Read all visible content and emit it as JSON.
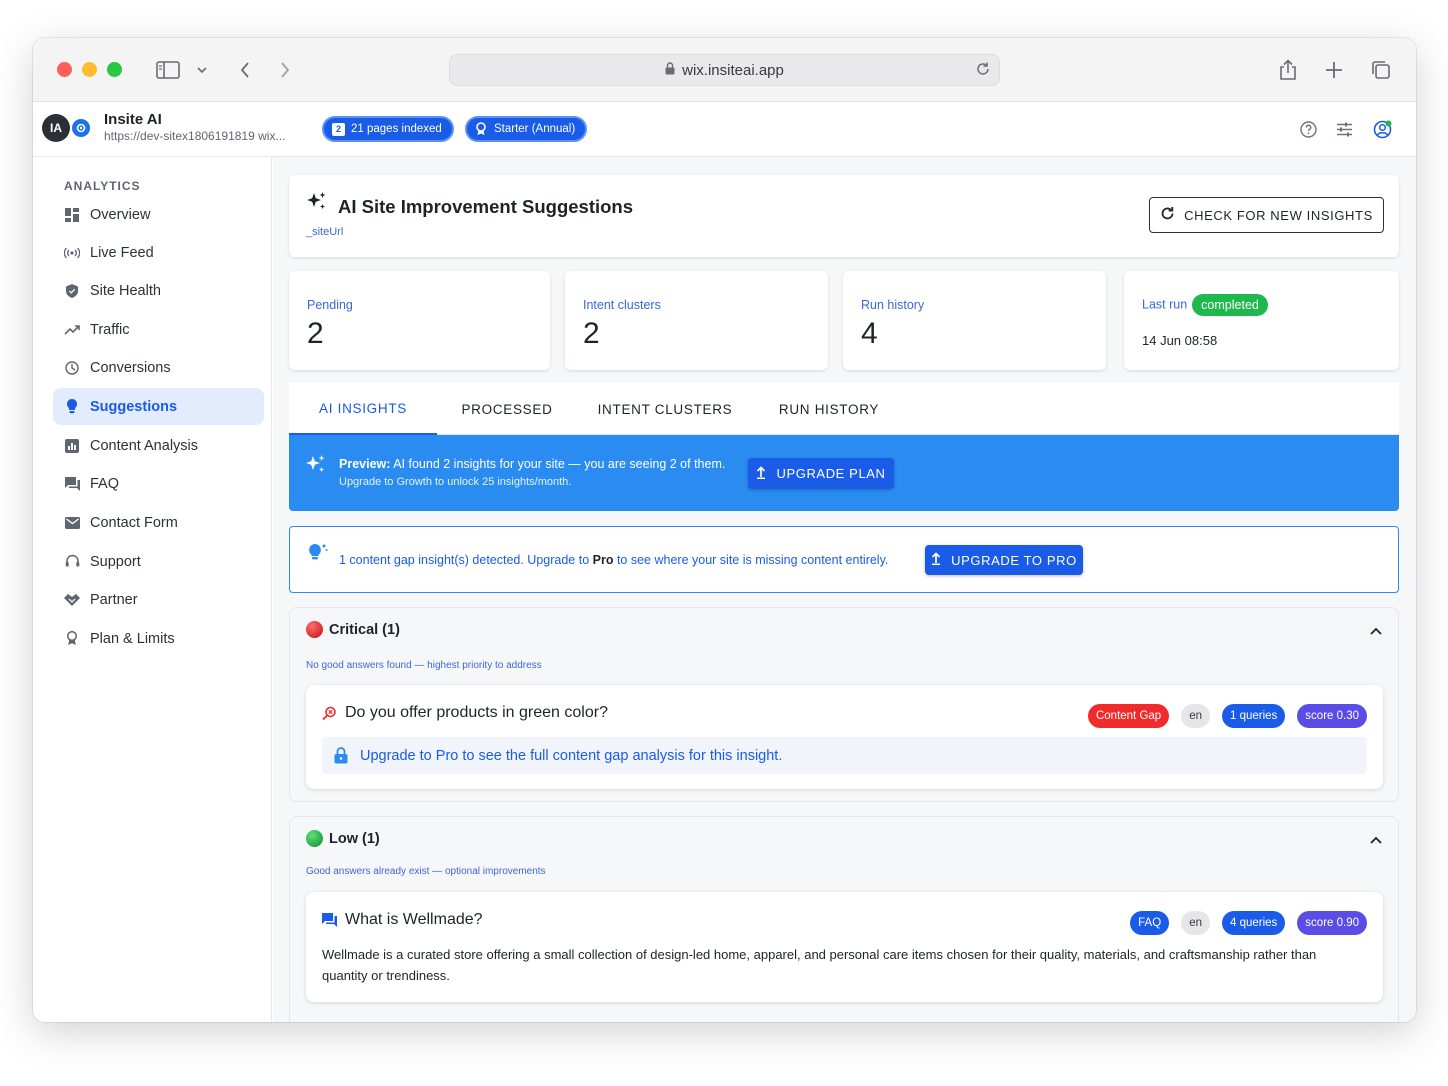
{
  "browser": {
    "url": "wix.insiteai.app"
  },
  "header": {
    "avatar_initials": "IA",
    "app_title": "Insite AI",
    "site_url": "https://dev-sitex1806191819 wix...",
    "pages_badge_icon": "2",
    "pages_badge": "21 pages indexed",
    "plan_badge": "Starter (Annual)"
  },
  "sidebar": {
    "section_label": "ANALYTICS",
    "items": [
      {
        "label": "Overview",
        "icon": "grid-icon"
      },
      {
        "label": "Live Feed",
        "icon": "broadcast-icon"
      },
      {
        "label": "Site Health",
        "icon": "shield-icon"
      },
      {
        "label": "Traffic",
        "icon": "trend-icon"
      },
      {
        "label": "Conversions",
        "icon": "conversions-icon"
      },
      {
        "label": "Suggestions",
        "icon": "bulb-icon",
        "active": true
      },
      {
        "label": "Content Analysis",
        "icon": "analysis-icon"
      },
      {
        "label": "FAQ",
        "icon": "chat-icon"
      },
      {
        "label": "Contact Form",
        "icon": "mail-icon"
      },
      {
        "label": "Support",
        "icon": "support-icon"
      },
      {
        "label": "Partner",
        "icon": "handshake-icon"
      },
      {
        "label": "Plan & Limits",
        "icon": "award-icon"
      }
    ]
  },
  "page": {
    "title": "AI Site Improvement Suggestions",
    "subtitle": "_siteUrl",
    "check_button": "CHECK FOR NEW INSIGHTS"
  },
  "stats": {
    "pending_label": "Pending",
    "pending_value": "2",
    "clusters_label": "Intent clusters",
    "clusters_value": "2",
    "history_label": "Run history",
    "history_value": "4",
    "last_run_label": "Last run",
    "last_run_status": "completed",
    "last_run_time": "14 Jun 08:58"
  },
  "tabs": [
    "AI INSIGHTS",
    "PROCESSED",
    "INTENT CLUSTERS",
    "RUN HISTORY"
  ],
  "preview_banner": {
    "bold": "Preview:",
    "text": " AI found 2 insights for your site — you are seeing 2 of them.",
    "sub": "Upgrade to Growth to unlock 25 insights/month.",
    "button": "UPGRADE PLAN"
  },
  "gap_banner": {
    "text_before": "1 content gap insight(s) detected. Upgrade to ",
    "bold": "Pro",
    "text_after": " to see where your site is missing content entirely.",
    "button": "UPGRADE TO PRO"
  },
  "groups": [
    {
      "title": "Critical (1)",
      "color": "#e0201c",
      "description": "No good answers found — highest priority to address",
      "insight": {
        "question": "Do you offer products in green color?",
        "chips": [
          "Content Gap",
          "en",
          "1 queries",
          "score 0.30"
        ],
        "upsell": "Upgrade to Pro to see the full content gap analysis for this insight."
      }
    },
    {
      "title": "Low (1)",
      "color": "#18a83a",
      "description": "Good answers already exist — optional improvements",
      "insight": {
        "question": "What is Wellmade?",
        "chips": [
          "FAQ",
          "en",
          "4 queries",
          "score 0.90"
        ],
        "answer": "Wellmade is a curated store offering a small collection of design-led home, apparel, and personal care items chosen for their quality, materials, and craftsmanship rather than quantity or trendiness."
      }
    }
  ],
  "colors": {
    "accent": "#1a5be8",
    "banner": "#2a8cf0",
    "success": "#1fb84f"
  }
}
